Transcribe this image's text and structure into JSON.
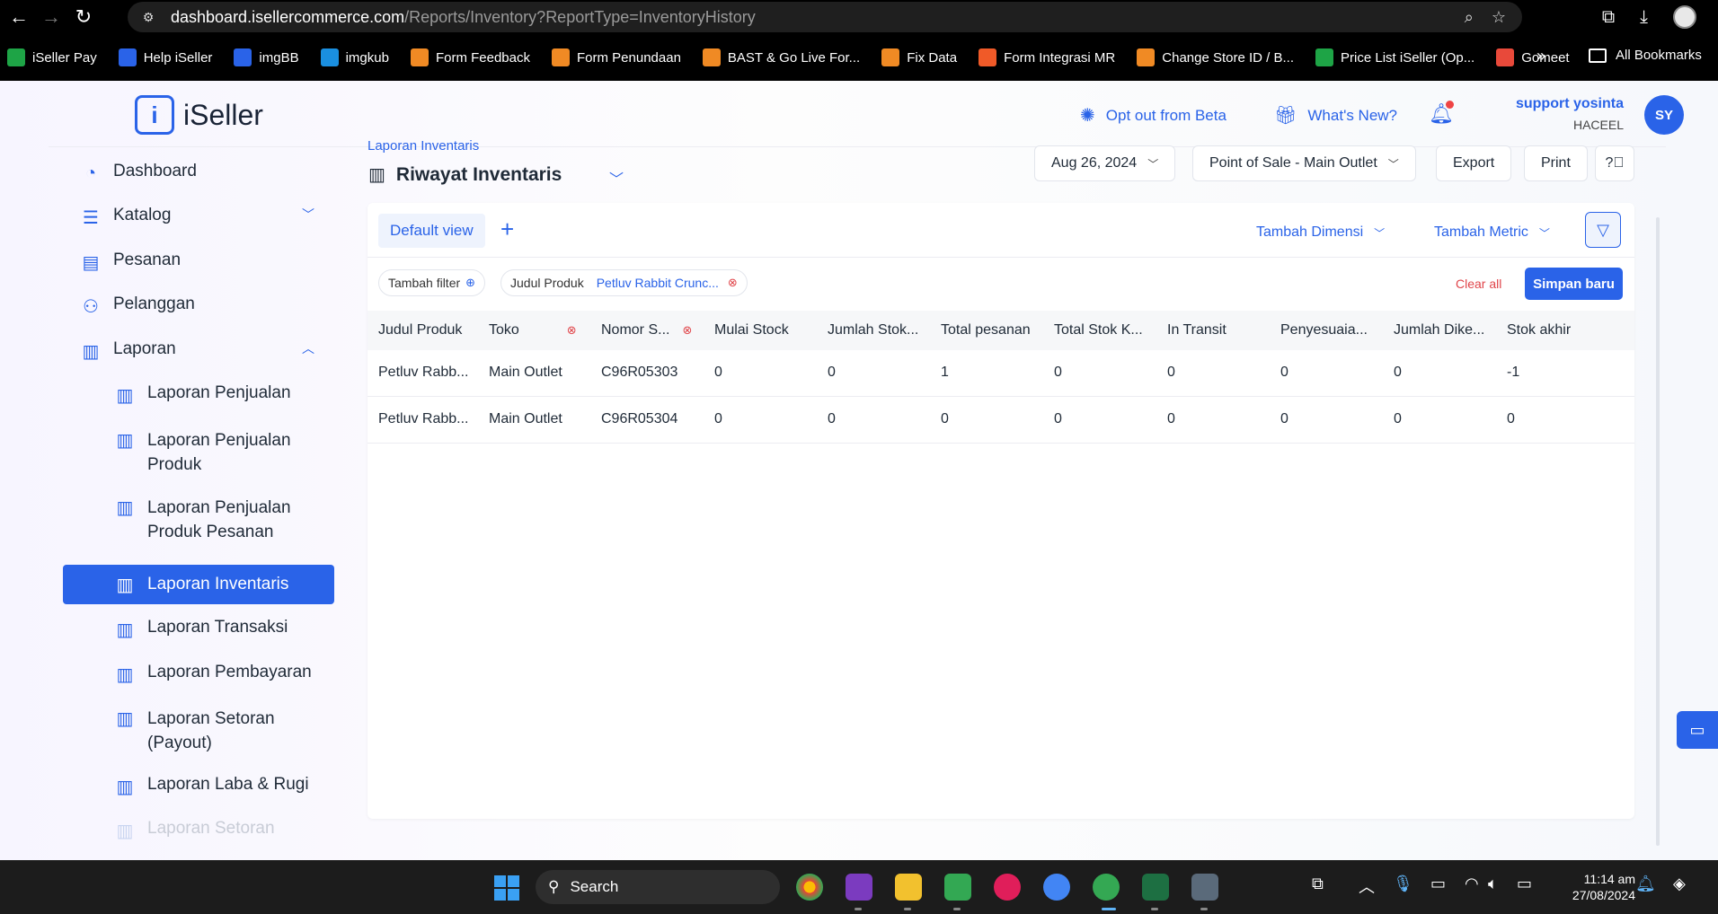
{
  "browser": {
    "url_host": "dashboard.isellercommerce.com",
    "url_path": "/Reports/Inventory?ReportType=InventoryHistory"
  },
  "bookmarks": [
    {
      "label": "iSeller Pay",
      "color": "#1ea446"
    },
    {
      "label": "Help iSeller",
      "color": "#2a63e8"
    },
    {
      "label": "imgBB",
      "color": "#2a63e8"
    },
    {
      "label": "imgkub",
      "color": "#1a8fe0"
    },
    {
      "label": "Form Feedback",
      "color": "#f08a24"
    },
    {
      "label": "Form Penundaan",
      "color": "#f08a24"
    },
    {
      "label": "BAST & Go Live For...",
      "color": "#f08a24"
    },
    {
      "label": "Fix Data",
      "color": "#f08a24"
    },
    {
      "label": "Form Integrasi MR",
      "color": "#f05a28"
    },
    {
      "label": "Change Store ID / B...",
      "color": "#f08a24"
    },
    {
      "label": "Price List iSeller (Op...",
      "color": "#1ea446"
    },
    {
      "label": "Gomeet",
      "color": "#e8493a"
    }
  ],
  "bookmarks_all": "All Bookmarks",
  "header": {
    "logo": "iSeller",
    "opt_out": "Opt out from Beta",
    "whats_new": "What's New?",
    "user_name": "support yosinta",
    "user_org": "HACEEL",
    "avatar": "SY"
  },
  "sidebar": {
    "items": [
      {
        "label": "Dashboard",
        "icon": "dashboard-icon"
      },
      {
        "label": "Katalog",
        "icon": "catalog-icon"
      },
      {
        "label": "Pesanan",
        "icon": "orders-icon"
      },
      {
        "label": "Pelanggan",
        "icon": "customers-icon"
      },
      {
        "label": "Laporan",
        "icon": "reports-icon"
      }
    ],
    "sub_items": [
      {
        "label": "Laporan Penjualan"
      },
      {
        "label": "Laporan Penjualan Produk"
      },
      {
        "label": "Laporan Penjualan Produk Pesanan"
      },
      {
        "label": "Laporan Inventaris"
      },
      {
        "label": "Laporan Transaksi"
      },
      {
        "label": "Laporan Pembayaran"
      },
      {
        "label": "Laporan Setoran (Payout)"
      },
      {
        "label": "Laporan Laba & Rugi"
      },
      {
        "label": "Laporan Setoran"
      }
    ]
  },
  "page": {
    "breadcrumb": "Laporan Inventaris",
    "title": "Riwayat Inventaris"
  },
  "toolbar": {
    "date": "Aug 26, 2024",
    "outlet": "Point of Sale - Main Outlet",
    "export": "Export",
    "print": "Print"
  },
  "view": {
    "tab": "Default view",
    "add_dimension": "Tambah Dimensi",
    "add_metric": "Tambah Metric"
  },
  "filters": {
    "add_filter": "Tambah filter",
    "chip_label": "Judul Produk",
    "chip_value": "Petluv Rabbit Crunc...",
    "clear_all": "Clear all",
    "save_new": "Simpan baru"
  },
  "table": {
    "columns": [
      "Judul Produk",
      "Toko",
      "Nomor S...",
      "Mulai Stock",
      "Jumlah Stok...",
      "Total pesanan",
      "Total Stok K...",
      "In Transit",
      "Penyesuaia...",
      "Jumlah Dike...",
      "Stok akhir"
    ],
    "rows": [
      [
        "Petluv Rabb...",
        "Main Outlet",
        "C96R05303",
        "0",
        "0",
        "1",
        "0",
        "0",
        "0",
        "0",
        "-1"
      ],
      [
        "Petluv Rabb...",
        "Main Outlet",
        "C96R05304",
        "0",
        "0",
        "0",
        "0",
        "0",
        "0",
        "0",
        "0"
      ]
    ]
  },
  "taskbar": {
    "search": "Search",
    "time": "11:14 am",
    "date": "27/08/2024"
  }
}
